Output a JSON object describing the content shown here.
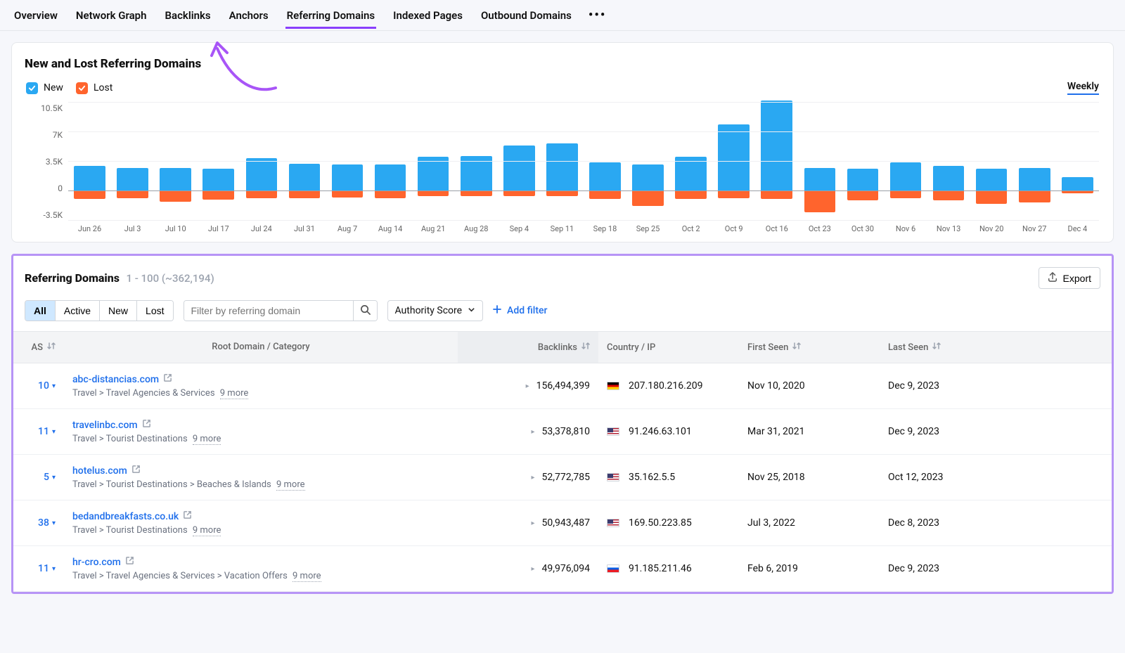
{
  "tabs": [
    "Overview",
    "Network Graph",
    "Backlinks",
    "Anchors",
    "Referring Domains",
    "Indexed Pages",
    "Outbound Domains"
  ],
  "active_tab_index": 4,
  "chart": {
    "title": "New and Lost Referring Domains",
    "legend": {
      "new": "New",
      "lost": "Lost"
    },
    "legend_colors": {
      "new": "#2aa8f2",
      "lost": "#ff642d"
    },
    "period_label": "Weekly"
  },
  "chart_data": {
    "type": "bar",
    "title": "New and Lost Referring Domains",
    "ylabel": "",
    "xlabel": "",
    "ylim": [
      -3500,
      10500
    ],
    "yticks": [
      "10.5K",
      "7K",
      "3.5K",
      "0",
      "-3.5K"
    ],
    "categories": [
      "Jun 26",
      "Jul 3",
      "Jul 10",
      "Jul 17",
      "Jul 24",
      "Jul 31",
      "Aug 7",
      "Aug 14",
      "Aug 21",
      "Aug 28",
      "Sep 4",
      "Sep 11",
      "Sep 18",
      "Sep 25",
      "Oct 2",
      "Oct 9",
      "Oct 16",
      "Oct 23",
      "Oct 30",
      "Nov 6",
      "Nov 13",
      "Nov 20",
      "Nov 27",
      "Dec 4"
    ],
    "series": [
      {
        "name": "New",
        "values": [
          2900,
          2700,
          2700,
          2600,
          3800,
          3200,
          3100,
          3100,
          4000,
          4100,
          5300,
          5600,
          3300,
          3100,
          4000,
          7800,
          10700,
          2700,
          2600,
          3300,
          2900,
          2600,
          2700,
          1600
        ]
      },
      {
        "name": "Lost",
        "values": [
          -1000,
          -900,
          -1300,
          -1100,
          -900,
          -900,
          -800,
          -900,
          -700,
          -700,
          -700,
          -700,
          -1000,
          -1800,
          -1000,
          -900,
          -1000,
          -2600,
          -1200,
          -900,
          -1200,
          -1600,
          -1400,
          -300
        ]
      }
    ]
  },
  "table_panel": {
    "title": "Referring Domains",
    "range": "1 - 100 (~362,194)",
    "export_label": "Export",
    "segments": [
      "All",
      "Active",
      "New",
      "Lost"
    ],
    "active_segment": 0,
    "search_placeholder": "Filter by referring domain",
    "sort_dropdown": "Authority Score",
    "add_filter": "Add filter",
    "columns": [
      "AS",
      "Root Domain / Category",
      "Backlinks",
      "Country / IP",
      "First Seen",
      "Last Seen"
    ],
    "rows": [
      {
        "as": "10",
        "domain": "abc-distancias.com",
        "category": "Travel > Travel Agencies & Services",
        "more": "9 more",
        "backlinks": "156,494,399",
        "flag": "de",
        "ip": "207.180.216.209",
        "first": "Nov 10, 2020",
        "last": "Dec 9, 2023"
      },
      {
        "as": "11",
        "domain": "travelinbc.com",
        "category": "Travel > Tourist Destinations",
        "more": "9 more",
        "backlinks": "53,378,810",
        "flag": "us",
        "ip": "91.246.63.101",
        "first": "Mar 31, 2021",
        "last": "Dec 9, 2023"
      },
      {
        "as": "5",
        "domain": "hotelus.com",
        "category": "Travel > Tourist Destinations > Beaches & Islands",
        "more": "9 more",
        "backlinks": "52,772,785",
        "flag": "us",
        "ip": "35.162.5.5",
        "first": "Nov 25, 2018",
        "last": "Oct 12, 2023"
      },
      {
        "as": "38",
        "domain": "bedandbreakfasts.co.uk",
        "category": "Travel > Tourist Destinations",
        "more": "9 more",
        "backlinks": "50,943,487",
        "flag": "us",
        "ip": "169.50.223.85",
        "first": "Jul 3, 2022",
        "last": "Dec 8, 2023"
      },
      {
        "as": "11",
        "domain": "hr-cro.com",
        "category": "Travel > Travel Agencies & Services > Vacation Offers",
        "more": "9 more",
        "backlinks": "49,976,094",
        "flag": "si",
        "ip": "91.185.211.46",
        "first": "Feb 6, 2019",
        "last": "Dec 9, 2023"
      }
    ]
  }
}
